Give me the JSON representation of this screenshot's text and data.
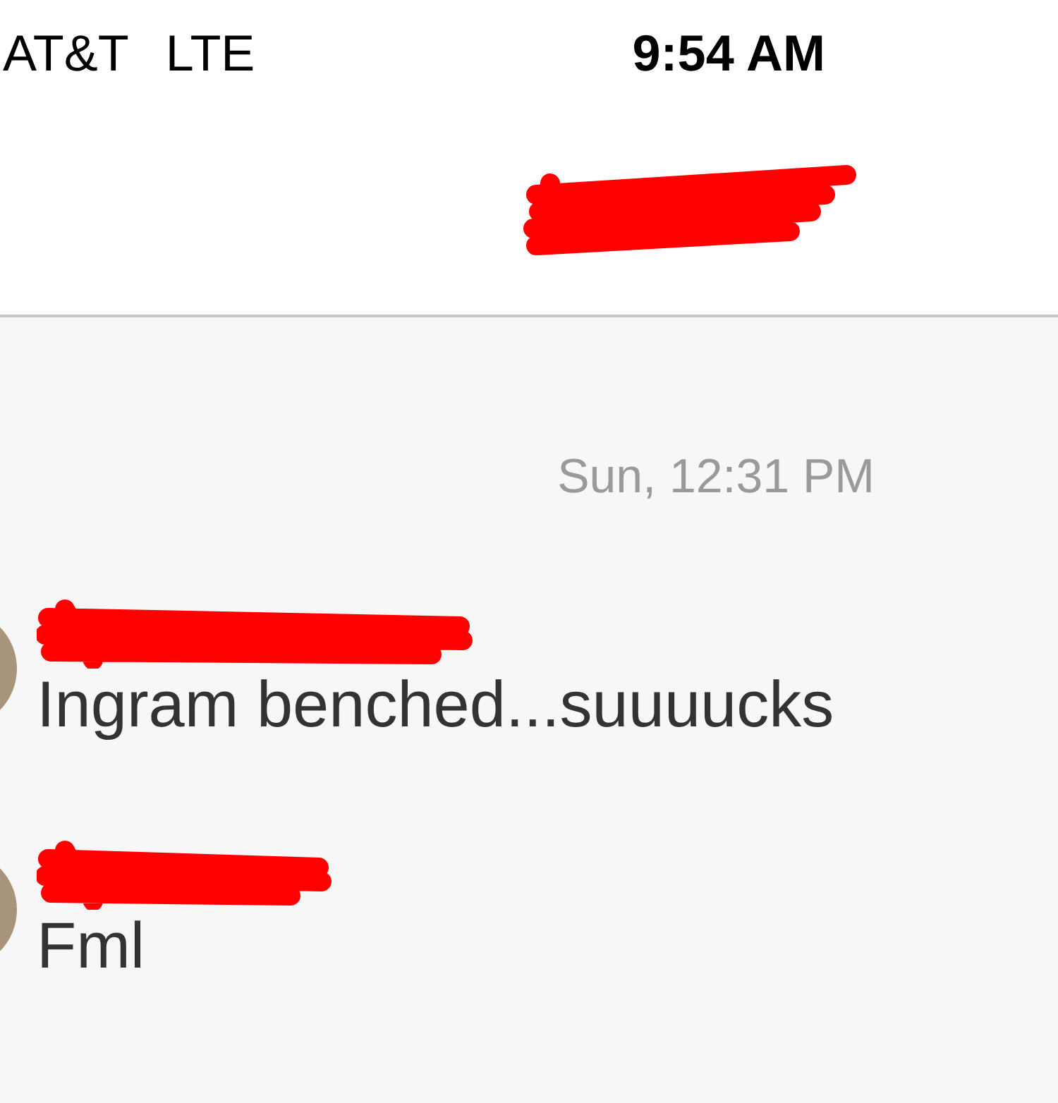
{
  "status_bar": {
    "carrier": "AT&T",
    "network": "LTE",
    "time": "9:54 AM"
  },
  "header": {
    "title_redacted": true
  },
  "timestamp": "Sun, 12:31 PM",
  "messages": [
    {
      "sender_redacted": true,
      "text": "Ingram benched...suuuucks"
    },
    {
      "sender_redacted": true,
      "text": "Fml"
    }
  ]
}
